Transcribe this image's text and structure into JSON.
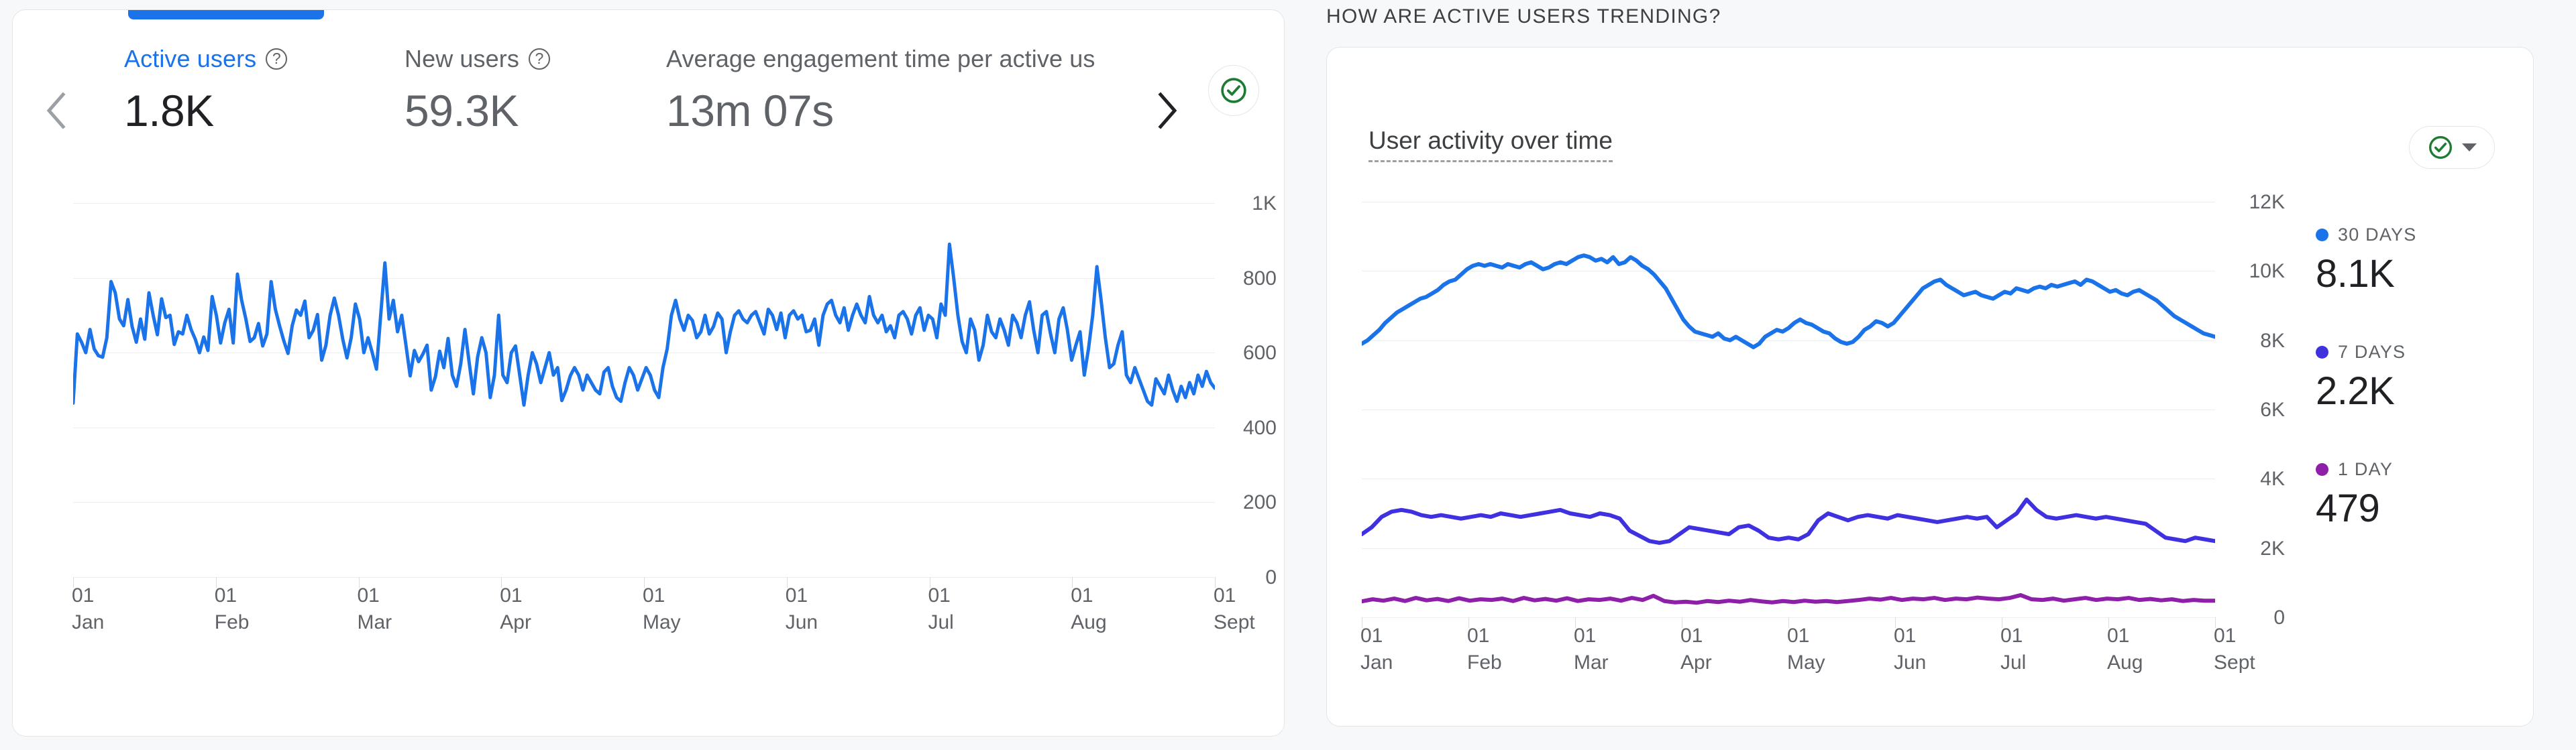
{
  "colors": {
    "accent_blue": "#1a73e8",
    "line_blue": "#1a73e8",
    "line_indigo": "#3f31e0",
    "line_purple": "#8e1fa8",
    "green_check": "#1e7b34",
    "text_primary": "#202124",
    "text_secondary": "#5f6368",
    "grid": "#eceef0",
    "card_bg": "#ffffff",
    "page_bg": "#f7f8f9"
  },
  "left_card": {
    "nav_prev_icon": "chevron-left-icon",
    "nav_next_icon": "chevron-right-icon",
    "status_icon": "check-circle-icon",
    "metrics": [
      {
        "label": "Active users",
        "value": "1.8K",
        "help_icon": "help-icon",
        "active": true
      },
      {
        "label": "New users",
        "value": "59.3K",
        "help_icon": "help-icon",
        "active": false
      },
      {
        "label": "Average engagement time per active us",
        "value": "13m 07s",
        "help_icon": "",
        "active": false
      }
    ]
  },
  "right_panel": {
    "section_title": "HOW ARE ACTIVE USERS TRENDING?",
    "card_title": "User activity over time",
    "pill_status_icon": "check-circle-icon",
    "pill_caret_icon": "chevron-down-icon",
    "legend": [
      {
        "name": "30 DAYS",
        "value": "8.1K",
        "color": "#1a73e8"
      },
      {
        "name": "7 DAYS",
        "value": "2.2K",
        "color": "#3f31e0"
      },
      {
        "name": "1 DAY",
        "value": "479",
        "color": "#8e1fa8"
      }
    ]
  },
  "chart_data": [
    {
      "id": "active-users-daily",
      "type": "line",
      "title": "Active users",
      "xlabel": "",
      "ylabel": "",
      "grid": true,
      "legend": "none",
      "ylim": [
        0,
        1000
      ],
      "yticks": [
        0,
        200,
        400,
        600,
        800,
        1000
      ],
      "ytick_labels": [
        "0",
        "200",
        "400",
        "600",
        "800",
        "1K"
      ],
      "xtick_labels": [
        "01\nJan",
        "01\nFeb",
        "01\nMar",
        "01\nApr",
        "01\nMay",
        "01\nJun",
        "01\nJul",
        "01\nAug",
        "01\nSept"
      ],
      "xtick_day": "01",
      "xtick_months": [
        "Jan",
        "Feb",
        "Mar",
        "Apr",
        "May",
        "Jun",
        "Jul",
        "Aug",
        "Sept"
      ],
      "series": [
        {
          "name": "Active users",
          "color": "#1a73e8",
          "values": [
            465,
            650,
            628,
            600,
            662,
            610,
            592,
            588,
            640,
            790,
            760,
            690,
            672,
            742,
            670,
            628,
            690,
            636,
            760,
            700,
            648,
            744,
            694,
            700,
            622,
            656,
            650,
            700,
            662,
            636,
            600,
            642,
            606,
            750,
            700,
            626,
            680,
            716,
            626,
            810,
            740,
            690,
            630,
            640,
            678,
            618,
            650,
            790,
            716,
            672,
            632,
            598,
            672,
            714,
            700,
            738,
            640,
            660,
            702,
            580,
            620,
            700,
            746,
            700,
            636,
            586,
            640,
            730,
            690,
            600,
            640,
            600,
            556,
            700,
            840,
            690,
            740,
            656,
            700,
            620,
            538,
            606,
            576,
            596,
            620,
            500,
            536,
            604,
            560,
            638,
            540,
            510,
            570,
            662,
            574,
            490,
            588,
            640,
            600,
            480,
            540,
            700,
            540,
            520,
            600,
            618,
            540,
            460,
            540,
            600,
            570,
            520,
            560,
            600,
            540,
            560,
            472,
            500,
            538,
            560,
            540,
            500,
            540,
            520,
            500,
            490,
            548,
            560,
            510,
            480,
            470,
            520,
            560,
            540,
            500,
            530,
            560,
            540,
            500,
            480,
            560,
            610,
            700,
            740,
            690,
            660,
            700,
            686,
            640,
            656,
            700,
            650,
            670,
            706,
            690,
            600,
            656,
            700,
            712,
            690,
            680,
            700,
            710,
            680,
            650,
            716,
            700,
            662,
            706,
            640,
            700,
            712,
            690,
            700,
            656,
            660,
            690,
            620,
            700,
            730,
            740,
            700,
            680,
            720,
            660,
            700,
            730,
            700,
            680,
            750,
            700,
            680,
            700,
            656,
            672,
            640,
            700,
            710,
            690,
            650,
            700,
            720,
            660,
            700,
            690,
            640,
            730,
            700,
            890,
            800,
            700,
            630,
            600,
            690,
            660,
            580,
            620,
            700,
            656,
            640,
            690,
            660,
            620,
            700,
            680,
            640,
            700,
            736,
            660,
            600,
            700,
            710,
            650,
            600,
            690,
            720,
            660,
            580,
            620,
            656,
            540,
            610,
            700,
            830,
            740,
            640,
            560,
            570,
            620,
            656,
            540,
            520,
            560,
            530,
            500,
            470,
            460,
            530,
            510,
            490,
            540,
            500,
            470,
            510,
            480,
            520,
            490,
            540,
            510,
            550,
            520,
            505
          ]
        }
      ]
    },
    {
      "id": "user-activity-over-time",
      "type": "line",
      "title": "User activity over time",
      "xlabel": "",
      "ylabel": "",
      "grid": true,
      "legend": "right",
      "ylim": [
        0,
        12000
      ],
      "yticks": [
        0,
        2000,
        4000,
        6000,
        8000,
        10000,
        12000
      ],
      "ytick_labels": [
        "0",
        "2K",
        "4K",
        "6K",
        "8K",
        "10K",
        "12K"
      ],
      "xtick_day": "01",
      "xtick_months": [
        "Jan",
        "Feb",
        "Mar",
        "Apr",
        "May",
        "Jun",
        "Jul",
        "Aug",
        "Sept"
      ],
      "series": [
        {
          "name": "30 DAYS",
          "color": "#1a73e8",
          "last_value": 8100,
          "values": [
            7900,
            8000,
            8150,
            8300,
            8500,
            8650,
            8800,
            8900,
            9000,
            9100,
            9200,
            9250,
            9350,
            9450,
            9600,
            9700,
            9750,
            9900,
            10050,
            10150,
            10200,
            10150,
            10200,
            10150,
            10100,
            10200,
            10150,
            10100,
            10200,
            10250,
            10150,
            10050,
            10100,
            10200,
            10250,
            10200,
            10300,
            10400,
            10450,
            10400,
            10300,
            10350,
            10250,
            10400,
            10200,
            10250,
            10400,
            10300,
            10150,
            10050,
            9900,
            9700,
            9500,
            9200,
            8900,
            8600,
            8400,
            8250,
            8200,
            8150,
            8100,
            8200,
            8050,
            8000,
            8100,
            8000,
            7900,
            7800,
            7900,
            8100,
            8200,
            8300,
            8250,
            8350,
            8500,
            8600,
            8500,
            8450,
            8350,
            8250,
            8200,
            8050,
            7950,
            7900,
            7950,
            8100,
            8300,
            8400,
            8550,
            8500,
            8400,
            8500,
            8700,
            8900,
            9100,
            9300,
            9500,
            9600,
            9700,
            9750,
            9600,
            9500,
            9400,
            9300,
            9350,
            9400,
            9300,
            9250,
            9200,
            9300,
            9400,
            9350,
            9500,
            9450,
            9400,
            9500,
            9550,
            9500,
            9600,
            9550,
            9600,
            9650,
            9700,
            9600,
            9750,
            9700,
            9600,
            9500,
            9400,
            9450,
            9350,
            9300,
            9400,
            9450,
            9350,
            9250,
            9150,
            9000,
            8850,
            8700,
            8600,
            8500,
            8400,
            8300,
            8200,
            8150,
            8100
          ]
        },
        {
          "name": "7 DAYS",
          "color": "#3f31e0",
          "last_value": 2200,
          "values": [
            2400,
            2600,
            2900,
            3050,
            3100,
            3050,
            2950,
            2900,
            2950,
            2900,
            2850,
            2900,
            2950,
            2900,
            3000,
            2950,
            2900,
            2950,
            3000,
            3050,
            3100,
            3000,
            2950,
            2900,
            3000,
            2950,
            2850,
            2500,
            2350,
            2200,
            2150,
            2200,
            2400,
            2600,
            2550,
            2500,
            2450,
            2400,
            2600,
            2650,
            2500,
            2300,
            2250,
            2300,
            2250,
            2400,
            2800,
            3000,
            2900,
            2800,
            2900,
            2950,
            2900,
            2850,
            2950,
            2900,
            2850,
            2800,
            2750,
            2800,
            2850,
            2900,
            2850,
            2900,
            2600,
            2800,
            3000,
            3400,
            3100,
            2900,
            2850,
            2900,
            2950,
            2900,
            2850,
            2900,
            2850,
            2800,
            2750,
            2700,
            2500,
            2300,
            2250,
            2200,
            2300,
            2250,
            2200
          ]
        },
        {
          "name": "1 DAY",
          "color": "#8e1fa8",
          "last_value": 479,
          "values": [
            460,
            520,
            480,
            540,
            470,
            560,
            490,
            530,
            470,
            550,
            480,
            520,
            500,
            540,
            470,
            560,
            490,
            530,
            480,
            550,
            470,
            520,
            500,
            540,
            480,
            560,
            500,
            620,
            470,
            430,
            450,
            420,
            470,
            440,
            480,
            450,
            500,
            460,
            430,
            470,
            440,
            480,
            450,
            470,
            440,
            470,
            500,
            540,
            510,
            560,
            500,
            540,
            520,
            560,
            500,
            540,
            520,
            570,
            540,
            520,
            560,
            640,
            520,
            500,
            540,
            480,
            520,
            560,
            500,
            540,
            520,
            560,
            500,
            530,
            490,
            520,
            470,
            500,
            480,
            479
          ]
        }
      ]
    }
  ]
}
